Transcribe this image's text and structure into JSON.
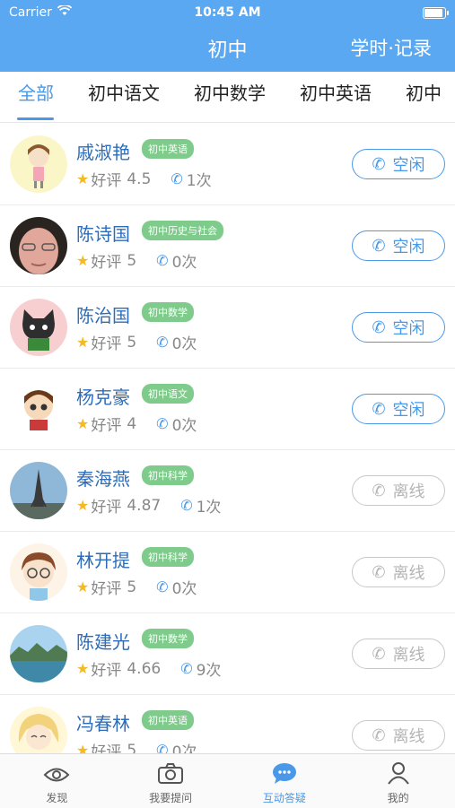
{
  "status_bar": {
    "carrier": "Carrier",
    "time": "10:45 AM"
  },
  "nav": {
    "title": "初中",
    "right_action": "学时·记录"
  },
  "tabs": [
    {
      "label": "全部",
      "active": true
    },
    {
      "label": "初中语文"
    },
    {
      "label": "初中数学"
    },
    {
      "label": "初中英语"
    },
    {
      "label": "初中"
    }
  ],
  "teachers": [
    {
      "name": "戚淑艳",
      "subject": "初中英语",
      "rating_label": "好评",
      "rating": "4.5",
      "calls": "1次",
      "status": "空闲"
    },
    {
      "name": "陈诗国",
      "subject": "初中历史与社会",
      "rating_label": "好评",
      "rating": "5",
      "calls": "0次",
      "status": "空闲"
    },
    {
      "name": "陈治国",
      "subject": "初中数学",
      "rating_label": "好评",
      "rating": "5",
      "calls": "0次",
      "status": "空闲"
    },
    {
      "name": "杨克豪",
      "subject": "初中语文",
      "rating_label": "好评",
      "rating": "4",
      "calls": "0次",
      "status": "空闲"
    },
    {
      "name": "秦海燕",
      "subject": "初中科学",
      "rating_label": "好评",
      "rating": "4.87",
      "calls": "1次",
      "status": "离线"
    },
    {
      "name": "林开提",
      "subject": "初中科学",
      "rating_label": "好评",
      "rating": "5",
      "calls": "0次",
      "status": "离线"
    },
    {
      "name": "陈建光",
      "subject": "初中数学",
      "rating_label": "好评",
      "rating": "4.66",
      "calls": "9次",
      "status": "离线"
    },
    {
      "name": "冯春林",
      "subject": "初中英语",
      "rating_label": "好评",
      "rating": "5",
      "calls": "0次",
      "status": "离线"
    }
  ],
  "bottom_tabs": [
    {
      "label": "发现",
      "icon": "eye-icon"
    },
    {
      "label": "我要提问",
      "icon": "camera-icon"
    },
    {
      "label": "互动答疑",
      "icon": "chat-icon",
      "active": true
    },
    {
      "label": "我的",
      "icon": "person-icon"
    }
  ],
  "colors": {
    "accent": "#4a98e8",
    "header": "#5aa7f2",
    "badge": "#7fcb8c",
    "star": "#f5b921"
  }
}
